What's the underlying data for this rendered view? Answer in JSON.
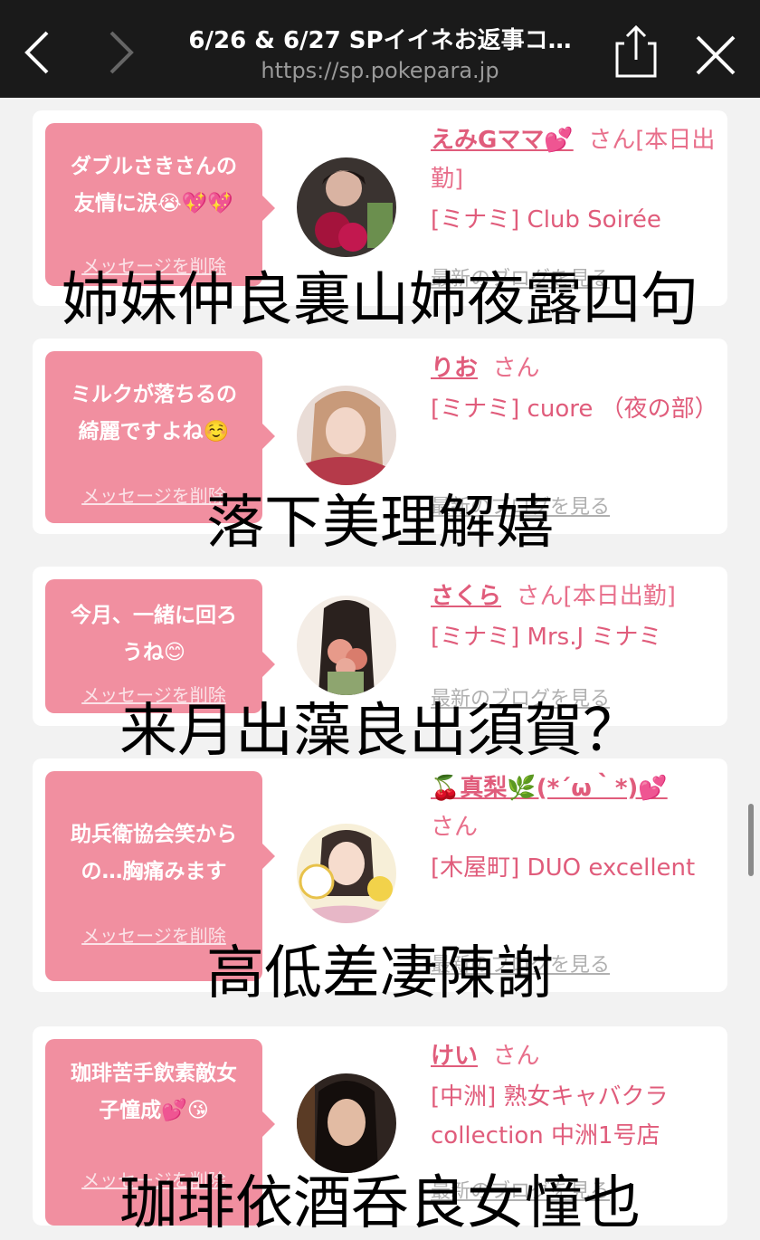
{
  "browser": {
    "title": "6/26 & 6/27 SPイイネお返事コ…",
    "url": "https://sp.pokepara.jp"
  },
  "colors": {
    "accent": "#e05c7b",
    "bubble": "#f18fa0",
    "topbar": "#1a1a1a"
  },
  "cards": [
    {
      "message_lines": [
        "ダブルさきさんの",
        "友情に涙😭💖💖"
      ],
      "delete_label": "メッセージを削除",
      "name": "えみGママ💕",
      "name_suffix": "さん[本日出勤]",
      "shop": "[ミナミ] Club Soirée",
      "blog_label": "最新のブログを見る"
    },
    {
      "message_lines": [
        "ミルクが落ちるの",
        "綺麗ですよね☺️"
      ],
      "delete_label": "メッセージを削除",
      "name": "りお",
      "name_suffix": "さん",
      "shop": "[ミナミ] cuore （夜の部）",
      "blog_label": "最新のブログを見る"
    },
    {
      "message_lines": [
        "今月、一緒に回ろ",
        "うね😊"
      ],
      "delete_label": "メッセージを削除",
      "name": "さくら",
      "name_suffix": "さん[本日出勤]",
      "shop": "[ミナミ] Mrs.J ミナミ",
      "blog_label": "最新のブログを見る"
    },
    {
      "message_lines": [
        "助兵衛協会笑から",
        "の…胸痛みます"
      ],
      "delete_label": "メッセージを削除",
      "name": "🍒真梨🌿(*´ω｀*)💕",
      "name_suffix": "さん",
      "shop": "[木屋町] DUO excellent",
      "blog_label": "最新のブログを見る"
    },
    {
      "message_lines": [
        "珈琲苦手飲素敵女",
        "子憧成💕😘"
      ],
      "delete_label": "メッセージを削除",
      "name": "けい",
      "name_suffix": "さん",
      "shop": "[中洲] 熟女キャバクラ collection 中洲1号店",
      "blog_label": "最新のブログを見る"
    }
  ],
  "overlays": [
    "姉妹仲良裏山姉夜露四句",
    "落下美理解嬉",
    "来月出藻良出須賀？",
    "高低差凄陳謝",
    "珈琲依酒呑良女憧也"
  ]
}
